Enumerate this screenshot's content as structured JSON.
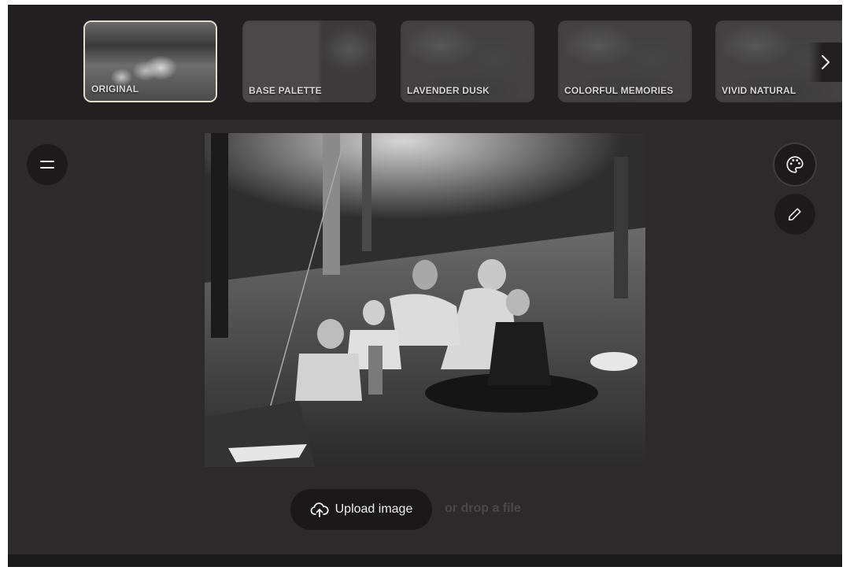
{
  "filters": [
    {
      "label": "ORIGINAL",
      "selected": true
    },
    {
      "label": "BASE PALETTE",
      "selected": false
    },
    {
      "label": "LAVENDER DUSK",
      "selected": false
    },
    {
      "label": "COLORFUL MEMORIES",
      "selected": false
    },
    {
      "label": "VIVID NATURAL",
      "selected": false
    }
  ],
  "icons": {
    "next": "chevron-right-icon",
    "menu": "menu-icon",
    "palette": "palette-icon",
    "edit": "pencil-icon",
    "upload": "cloud-upload-icon"
  },
  "upload": {
    "button_label": "Upload image",
    "drop_text": "or drop a file"
  },
  "colors": {
    "background": "#2c2a2b",
    "filmstrip": "#221f20",
    "selected_border": "#e4ddca",
    "button": "#1a1818"
  }
}
